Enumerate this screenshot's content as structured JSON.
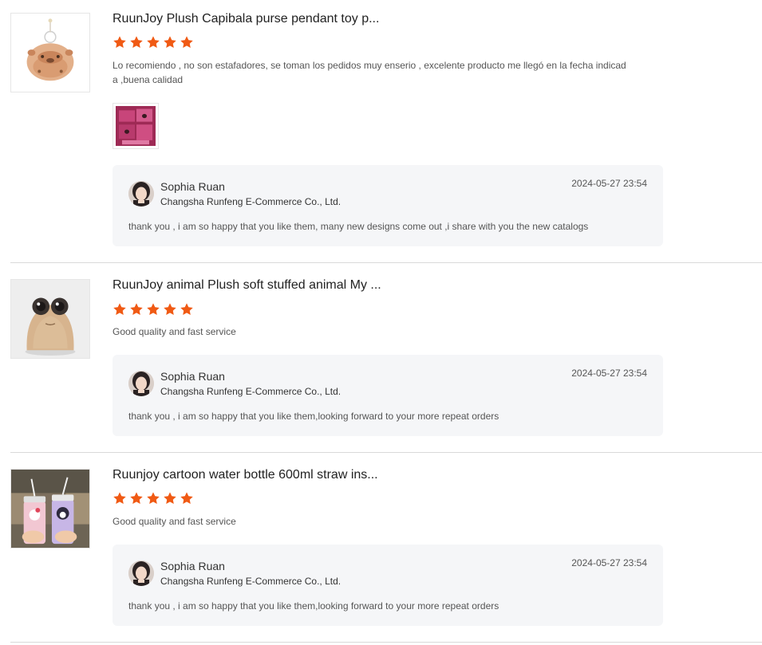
{
  "colors": {
    "star": "#f05a14",
    "reply_bg": "#f5f6f8",
    "separator": "#d9d9d9"
  },
  "reviews": [
    {
      "product_title": "RuunJoy Plush Capibala purse pendant toy p...",
      "rating": 5,
      "comment": "Lo recomiendo , no son estafadores, se toman los pedidos muy enserio , excelente producto me llegó en la fecha indicad a ,buena calidad",
      "product_image_icon": "capybara-plush-image",
      "has_attachment": true,
      "reply": {
        "name": "Sophia Ruan",
        "company": "Changsha Runfeng E-Commerce Co., Ltd.",
        "date": "2024-05-27 23:54",
        "text": "thank you , i am so happy that you like them,  many new designs come out ,i share with you the new catalogs"
      }
    },
    {
      "product_title": "RuunJoy animal Plush soft stuffed animal My ...",
      "rating": 5,
      "comment": "Good quality and fast service",
      "product_image_icon": "pou-plush-image",
      "has_attachment": false,
      "reply": {
        "name": "Sophia Ruan",
        "company": "Changsha Runfeng E-Commerce Co., Ltd.",
        "date": "2024-05-27 23:54",
        "text": "thank you , i am so happy that you like them,looking forward to your more repeat orders"
      }
    },
    {
      "product_title": "Ruunjoy cartoon water bottle 600ml straw ins...",
      "rating": 5,
      "comment": "Good quality and fast service",
      "product_image_icon": "water-bottle-image",
      "has_attachment": false,
      "reply": {
        "name": "Sophia Ruan",
        "company": "Changsha Runfeng E-Commerce Co., Ltd.",
        "date": "2024-05-27 23:54",
        "text": "thank you , i am so happy that you like them,looking forward to your more repeat orders"
      }
    }
  ]
}
